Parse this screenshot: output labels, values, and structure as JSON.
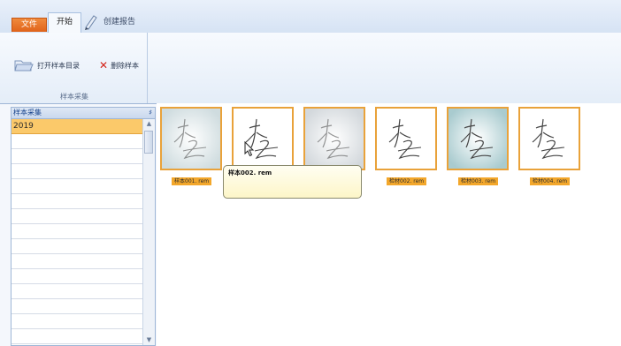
{
  "tabs": {
    "file": "文件",
    "start": "开始",
    "report": "创建报告"
  },
  "ribbon": {
    "open_dir": "打开样本目录",
    "delete": "删除样本",
    "group_label": "样本采集"
  },
  "panel": {
    "title": "样本采集",
    "pin": "♯",
    "items": [
      "2019",
      "",
      "",
      "",
      "",
      "",
      "",
      "",
      "",
      "",
      "",
      "",
      "",
      "",
      ""
    ]
  },
  "thumbnails": [
    {
      "caption": "样本001. rem",
      "bg": "#cfdcdf"
    },
    {
      "caption": "样本002. rem",
      "bg": "#ffffff"
    },
    {
      "caption": "",
      "bg": "#d3d8dc"
    },
    {
      "caption": "检材002. rem",
      "bg": "#ffffff"
    },
    {
      "caption": "检材003. rem",
      "bg": "#a9cbcf"
    },
    {
      "caption": "检材004. rem",
      "bg": "#ffffff"
    }
  ],
  "tooltip": {
    "text": "样本002. rem"
  },
  "colors": {
    "accent": "#f3a72b",
    "selection": "#fbc96a",
    "file_tab": "#e0631a"
  }
}
